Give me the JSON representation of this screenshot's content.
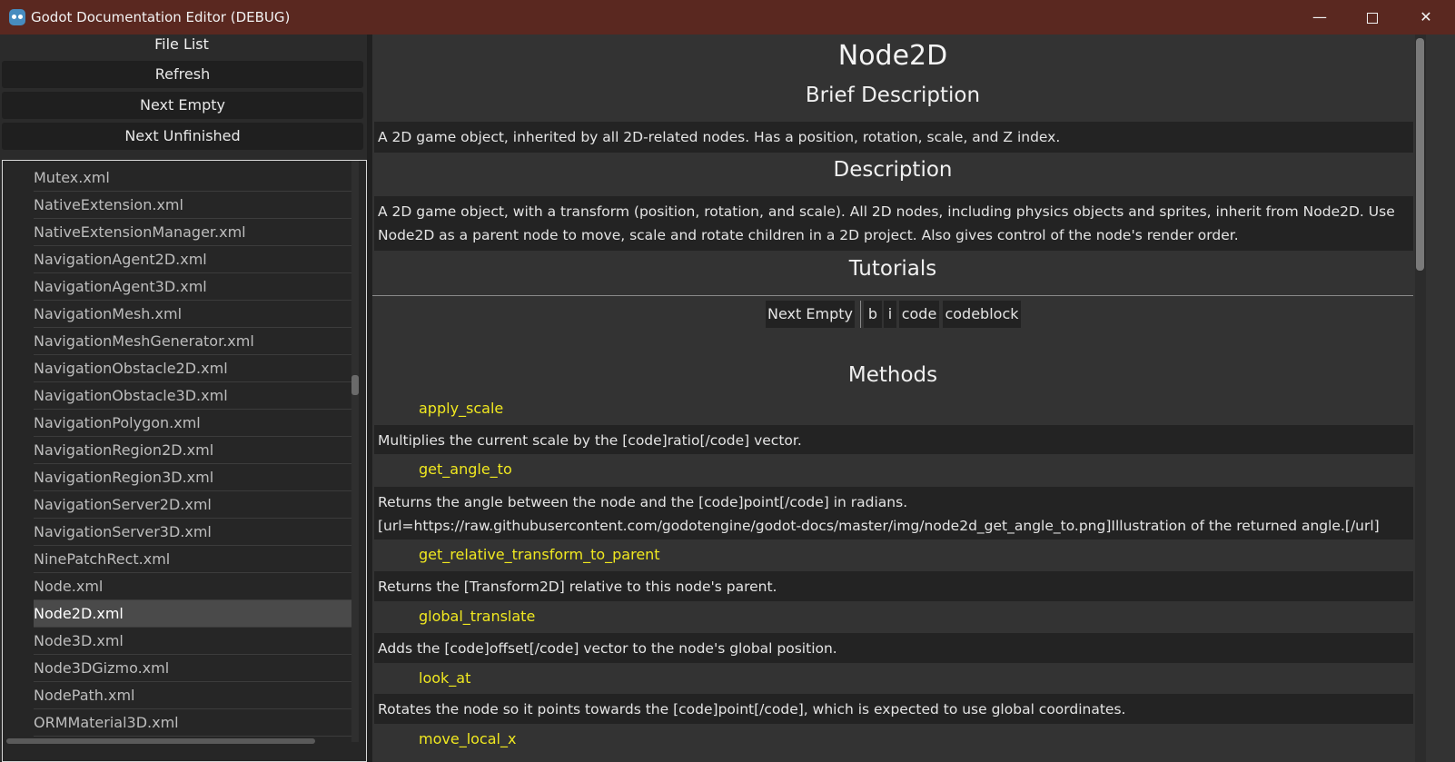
{
  "window": {
    "title": "Godot Documentation Editor (DEBUG)",
    "minimize_glyph": "—",
    "close_glyph": "✕"
  },
  "left_panel": {
    "header": "File List",
    "buttons": {
      "refresh": "Refresh",
      "next_empty": "Next Empty",
      "next_unfinished": "Next Unfinished"
    },
    "files": [
      "Mutex.xml",
      "NativeExtension.xml",
      "NativeExtensionManager.xml",
      "NavigationAgent2D.xml",
      "NavigationAgent3D.xml",
      "NavigationMesh.xml",
      "NavigationMeshGenerator.xml",
      "NavigationObstacle2D.xml",
      "NavigationObstacle3D.xml",
      "NavigationPolygon.xml",
      "NavigationRegion2D.xml",
      "NavigationRegion3D.xml",
      "NavigationServer2D.xml",
      "NavigationServer3D.xml",
      "NinePatchRect.xml",
      "Node.xml",
      "Node2D.xml",
      "Node3D.xml",
      "Node3DGizmo.xml",
      "NodePath.xml",
      "ORMMaterial3D.xml"
    ],
    "selected_file": "Node2D.xml"
  },
  "doc": {
    "class_name": "Node2D",
    "brief_heading": "Brief Description",
    "brief": "A 2D game object, inherited by all 2D-related nodes. Has a position, rotation, scale, and Z index.",
    "description_heading": "Description",
    "description_line1": "A 2D game object, with a transform (position, rotation, and scale). All 2D nodes, including physics objects and sprites, inherit from Node2D. Use",
    "description_line2": "Node2D as a parent node to move, scale and rotate children in a 2D project. Also gives control of the node's render order.",
    "tutorials_heading": "Tutorials",
    "toolbar": {
      "next_empty": "Next Empty",
      "bold": "b",
      "italic": "i",
      "code": "code",
      "codeblock": "codeblock"
    },
    "methods_heading": "Methods",
    "methods": [
      {
        "name": "apply_scale",
        "desc": "Multiplies the current scale by the [code]ratio[/code] vector."
      },
      {
        "name": "get_angle_to",
        "desc": "Returns the angle between the node and the [code]point[/code] in radians.",
        "desc2": "[url=https://raw.githubusercontent.com/godotengine/godot-docs/master/img/node2d_get_angle_to.png]Illustration of the returned angle.[/url]"
      },
      {
        "name": "get_relative_transform_to_parent",
        "desc": "Returns the [Transform2D] relative to this node's parent."
      },
      {
        "name": "global_translate",
        "desc": "Adds the [code]offset[/code] vector to the node's global position."
      },
      {
        "name": "look_at",
        "desc": "Rotates the node so it points towards the [code]point[/code], which is expected to use global coordinates."
      },
      {
        "name": "move_local_x"
      }
    ]
  },
  "colors": {
    "titlebar": "#5a2820",
    "method_name": "#f0e820",
    "panel_bg": "#333333",
    "desc_bg": "#232323"
  }
}
